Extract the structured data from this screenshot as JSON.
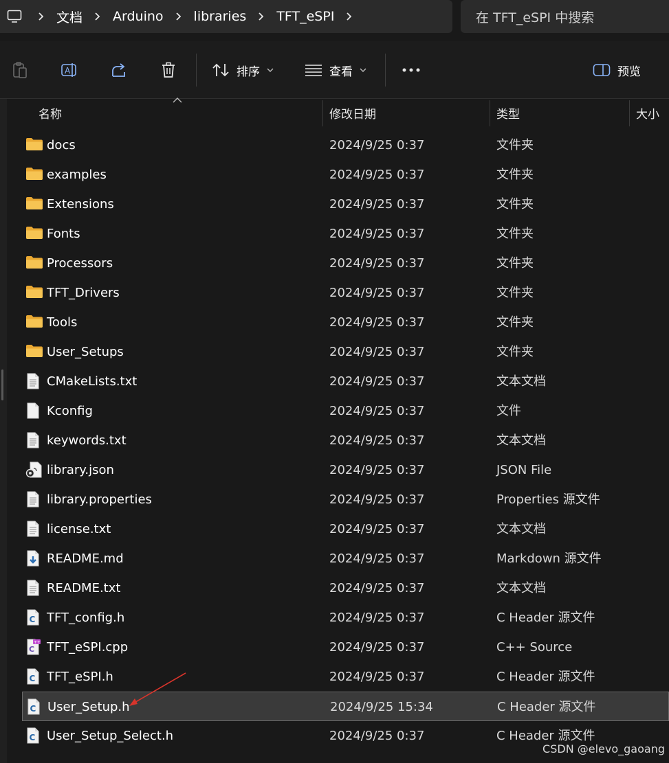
{
  "address_bar": {
    "crumbs": [
      "文档",
      "Arduino",
      "libraries",
      "TFT_eSPI"
    ]
  },
  "search": {
    "placeholder": "在 TFT_eSPI 中搜索"
  },
  "toolbar": {
    "sort_label": "排序",
    "view_label": "查看",
    "preview_label": "预览"
  },
  "columns": {
    "name": "名称",
    "date": "修改日期",
    "type": "类型",
    "size": "大小"
  },
  "files": [
    {
      "name": "docs",
      "date": "2024/9/25 0:37",
      "type": "文件夹",
      "icon": "folder-icon"
    },
    {
      "name": "examples",
      "date": "2024/9/25 0:37",
      "type": "文件夹",
      "icon": "folder-icon"
    },
    {
      "name": "Extensions",
      "date": "2024/9/25 0:37",
      "type": "文件夹",
      "icon": "folder-icon"
    },
    {
      "name": "Fonts",
      "date": "2024/9/25 0:37",
      "type": "文件夹",
      "icon": "folder-icon"
    },
    {
      "name": "Processors",
      "date": "2024/9/25 0:37",
      "type": "文件夹",
      "icon": "folder-icon"
    },
    {
      "name": "TFT_Drivers",
      "date": "2024/9/25 0:37",
      "type": "文件夹",
      "icon": "folder-icon"
    },
    {
      "name": "Tools",
      "date": "2024/9/25 0:37",
      "type": "文件夹",
      "icon": "folder-icon"
    },
    {
      "name": "User_Setups",
      "date": "2024/9/25 0:37",
      "type": "文件夹",
      "icon": "folder-icon"
    },
    {
      "name": "CMakeLists.txt",
      "date": "2024/9/25 0:37",
      "type": "文本文档",
      "icon": "text-file-icon"
    },
    {
      "name": "Kconfig",
      "date": "2024/9/25 0:37",
      "type": "文件",
      "icon": "blank-file-icon"
    },
    {
      "name": "keywords.txt",
      "date": "2024/9/25 0:37",
      "type": "文本文档",
      "icon": "text-file-icon"
    },
    {
      "name": "library.json",
      "date": "2024/9/25 0:37",
      "type": "JSON File",
      "icon": "json-file-icon"
    },
    {
      "name": "library.properties",
      "date": "2024/9/25 0:37",
      "type": "Properties 源文件",
      "icon": "text-file-icon"
    },
    {
      "name": "license.txt",
      "date": "2024/9/25 0:37",
      "type": "文本文档",
      "icon": "text-file-icon"
    },
    {
      "name": "README.md",
      "date": "2024/9/25 0:37",
      "type": "Markdown 源文件",
      "icon": "markdown-file-icon"
    },
    {
      "name": "README.txt",
      "date": "2024/9/25 0:37",
      "type": "文本文档",
      "icon": "text-file-icon"
    },
    {
      "name": "TFT_config.h",
      "date": "2024/9/25 0:37",
      "type": "C Header 源文件",
      "icon": "c-header-file-icon"
    },
    {
      "name": "TFT_eSPI.cpp",
      "date": "2024/9/25 0:37",
      "type": "C++ Source",
      "icon": "cpp-file-icon"
    },
    {
      "name": "TFT_eSPI.h",
      "date": "2024/9/25 0:37",
      "type": "C Header 源文件",
      "icon": "c-header-file-icon"
    },
    {
      "name": "User_Setup.h",
      "date": "2024/9/25 15:34",
      "type": "C Header 源文件",
      "icon": "c-header-file-icon",
      "selected": true
    },
    {
      "name": "User_Setup_Select.h",
      "date": "2024/9/25 0:37",
      "type": "C Header 源文件",
      "icon": "c-header-file-icon"
    }
  ],
  "watermark": "CSDN @elevo_gaoang",
  "colors": {
    "background": "#191919",
    "folder": "#f2c14e",
    "annotation_arrow": "#d9342b",
    "selection": "#3a3a3a"
  }
}
